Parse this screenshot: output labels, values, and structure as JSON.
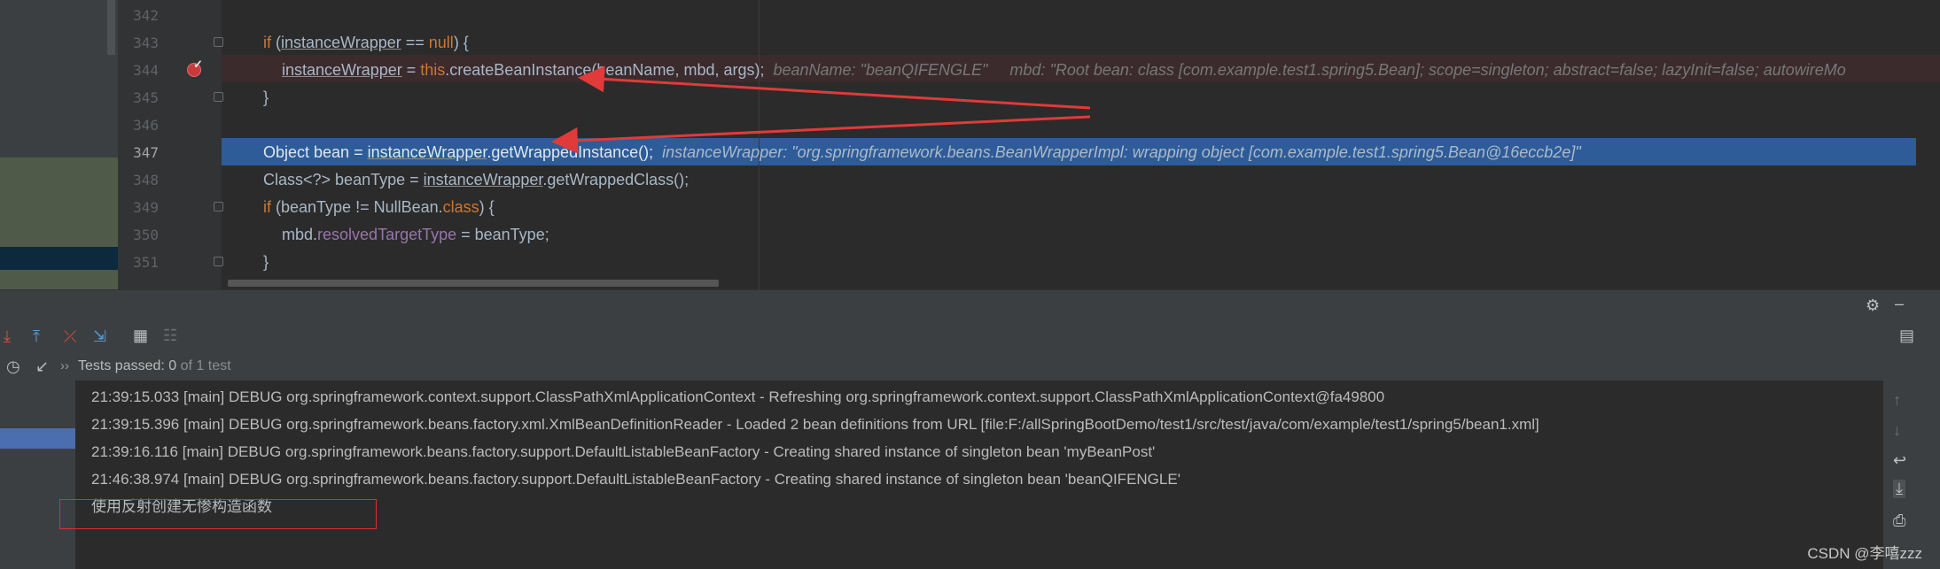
{
  "editor": {
    "line_numbers": [
      "342",
      "343",
      "344",
      "345",
      "346",
      "347",
      "348",
      "349",
      "350",
      "351"
    ],
    "lines": {
      "l343": {
        "if": "if",
        "open": " (",
        "var": "instanceWrapper",
        "op": " == ",
        "null": "null",
        "close": ") {"
      },
      "l344": {
        "var": "instanceWrapper",
        "eq": " = ",
        "this": "this",
        "call": ".createBeanInstance(beanName, mbd, args);",
        "hint1": "beanName: \"beanQIFENGLE\"",
        "hint2": "mbd: \"Root bean: class [com.example.test1.spring5.Bean]; scope=singleton; abstract=false; lazyInit=false; autowireMo"
      },
      "l345": {
        "text": "}"
      },
      "l347": {
        "pre": "Object bean = ",
        "var": "instanceWrapper",
        "call": ".getWrappedInstance();",
        "hint": "instanceWrapper: \"org.springframework.beans.BeanWrapperImpl: wrapping object [com.example.test1.spring5.Bean@16eccb2e]\""
      },
      "l348": {
        "pre": "Class<?> beanType = ",
        "var": "instanceWrapper",
        "call": ".getWrappedClass();"
      },
      "l349": {
        "if": "if",
        "rest": " (beanType != NullBean.",
        "cls": "class",
        "close": ") {"
      },
      "l350": {
        "pre": "mbd.",
        "field": "resolvedTargetType",
        "rest": " = beanType;"
      },
      "l351": {
        "text": "}"
      }
    }
  },
  "panel": {
    "tests_status": "Tests passed: ",
    "tests_count": "0",
    "tests_of": " of 1 test",
    "chevron": "››",
    "log_lines": [
      "21:39:15.033 [main] DEBUG org.springframework.context.support.ClassPathXmlApplicationContext - Refreshing org.springframework.context.support.ClassPathXmlApplicationContext@fa49800",
      "21:39:15.396 [main] DEBUG org.springframework.beans.factory.xml.XmlBeanDefinitionReader - Loaded 2 bean definitions from URL [file:F:/allSpringBootDemo/test1/src/test/java/com/example/test1/spring5/bean1.xml]",
      "21:39:16.116 [main] DEBUG org.springframework.beans.factory.support.DefaultListableBeanFactory - Creating shared instance of singleton bean 'myBeanPost'",
      "21:46:38.974 [main] DEBUG org.springframework.beans.factory.support.DefaultListableBeanFactory - Creating shared instance of singleton bean 'beanQIFENGLE'",
      "使用反射创建无惨构造函数"
    ]
  },
  "watermark": "CSDN @李嘻zzz",
  "colors": {
    "keyword": "#cc7832",
    "field": "#9876aa",
    "exec_line": "#2d5c99",
    "arrow": "#e03a3a"
  }
}
